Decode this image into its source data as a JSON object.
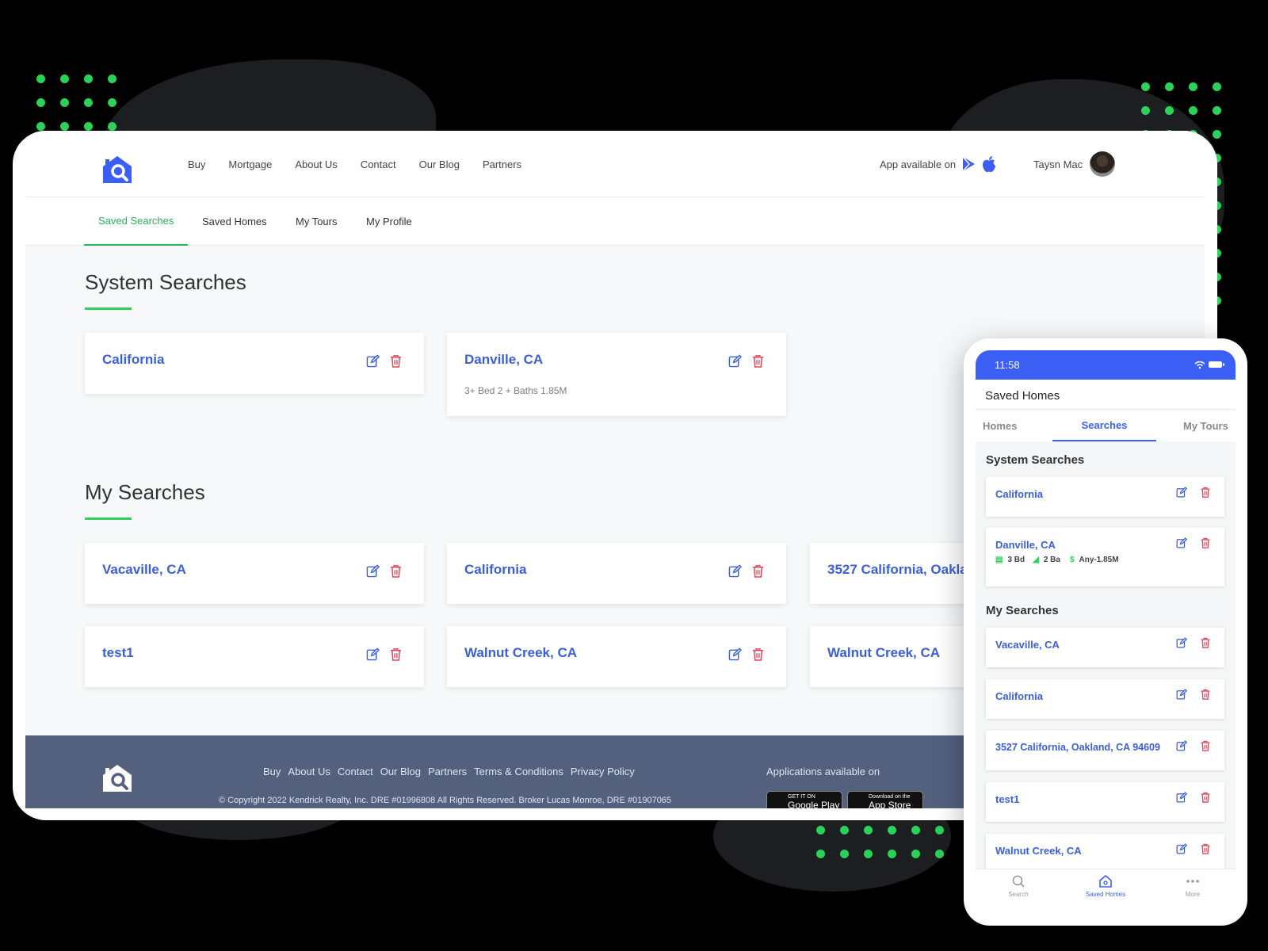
{
  "desktop": {
    "nav": [
      "Buy",
      "Mortgage",
      "About Us",
      "Contact",
      "Our Blog",
      "Partners"
    ],
    "app_available": "App available on",
    "user_name": "Taysn Mac",
    "tabs": [
      "Saved Searches",
      "Saved Homes",
      "My Tours",
      "My Profile"
    ],
    "active_tab": "Saved Searches",
    "system_searches_title": "System Searches",
    "system_searches": [
      {
        "title": "California",
        "subtitle": ""
      },
      {
        "title": "Danville, CA",
        "subtitle": "3+ Bed 2 + Baths 1.85M"
      }
    ],
    "my_searches_title": "My Searches",
    "my_searches": [
      {
        "title": "Vacaville, CA"
      },
      {
        "title": "California"
      },
      {
        "title": "3527 California, Oakla"
      },
      {
        "title": "test1"
      },
      {
        "title": "Walnut Creek, CA"
      },
      {
        "title": "Walnut Creek, CA"
      }
    ],
    "footer": {
      "links": [
        "Buy",
        "About Us",
        "Contact",
        "Our Blog",
        "Partners",
        "Terms & Conditions",
        "Privacy Policy"
      ],
      "copyright": "© Copyright 2022 Kendrick Realty, Inc. DRE #01996808 All Rights Reserved. Broker Lucas Monroe, DRE #01907065",
      "apps_label": "Applications available on",
      "google_play_top": "GET IT ON",
      "google_play": "Google Play",
      "app_store_top": "Download on the",
      "app_store": "App Store"
    }
  },
  "mobile": {
    "time": "11:58",
    "title": "Saved Homes",
    "tabs": [
      "Homes",
      "Searches",
      "My Tours"
    ],
    "active_tab": "Searches",
    "system_searches_title": "System Searches",
    "system_searches": [
      {
        "title": "California"
      },
      {
        "title": "Danville, CA",
        "beds": "3 Bd",
        "baths": "2 Ba",
        "price": "Any-1.85M"
      }
    ],
    "my_searches_title": "My Searches",
    "my_searches": [
      {
        "title": "Vacaville, CA"
      },
      {
        "title": "California"
      },
      {
        "title": "3527 California, Oakland, CA 94609"
      },
      {
        "title": "test1"
      },
      {
        "title": "Walnut Creek, CA"
      }
    ],
    "bottom_nav": [
      "Search",
      "Saved Homes",
      "More"
    ],
    "active_bottom": "Saved Homes"
  },
  "colors": {
    "accent_green": "#2bd158",
    "link_blue": "#3a5fd9",
    "delete_red": "#e0485a",
    "footer_bg": "#53617f",
    "phone_status": "#3b5ef5"
  }
}
